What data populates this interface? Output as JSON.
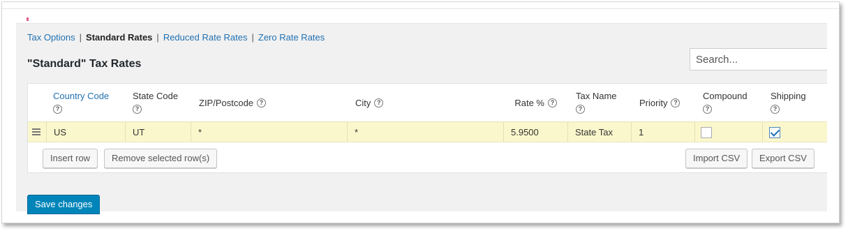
{
  "subnav": {
    "items": [
      {
        "label": "Tax Options",
        "current": false
      },
      {
        "label": "Standard Rates",
        "current": true
      },
      {
        "label": "Reduced Rate Rates",
        "current": false
      },
      {
        "label": "Zero Rate Rates",
        "current": false
      }
    ],
    "separator": "|"
  },
  "page_title": "\"Standard\" Tax Rates",
  "search": {
    "placeholder": "Search...",
    "value": ""
  },
  "table": {
    "columns": [
      {
        "label": "Country Code",
        "help_icon": "?"
      },
      {
        "label": "State Code",
        "help_icon": "?"
      },
      {
        "label": "ZIP/Postcode",
        "help_icon": "?"
      },
      {
        "label": "City",
        "help_icon": "?"
      },
      {
        "label": "Rate %",
        "help_icon": "?"
      },
      {
        "label": "Tax Name",
        "help_icon": "?"
      },
      {
        "label": "Priority",
        "help_icon": "?"
      },
      {
        "label": "Compound",
        "help_icon": "?"
      },
      {
        "label": "Shipping",
        "help_icon": "?"
      }
    ],
    "rows": [
      {
        "country": "US",
        "state": "UT",
        "postcode": "*",
        "city": "*",
        "rate": "5.9500",
        "tax_name": "State Tax",
        "priority": "1",
        "compound": false,
        "shipping": true
      }
    ]
  },
  "buttons": {
    "insert_row": "Insert row",
    "remove_rows": "Remove selected row(s)",
    "import_csv": "Import CSV",
    "export_csv": "Export CSV",
    "save": "Save changes"
  },
  "colors": {
    "link": "#2271b1",
    "primary": "#0085ba",
    "row_highlight": "#fbf7cc"
  },
  "icons": {
    "help": "help-icon",
    "drag": "drag-handle-icon",
    "checkmark": "checkmark-icon"
  }
}
